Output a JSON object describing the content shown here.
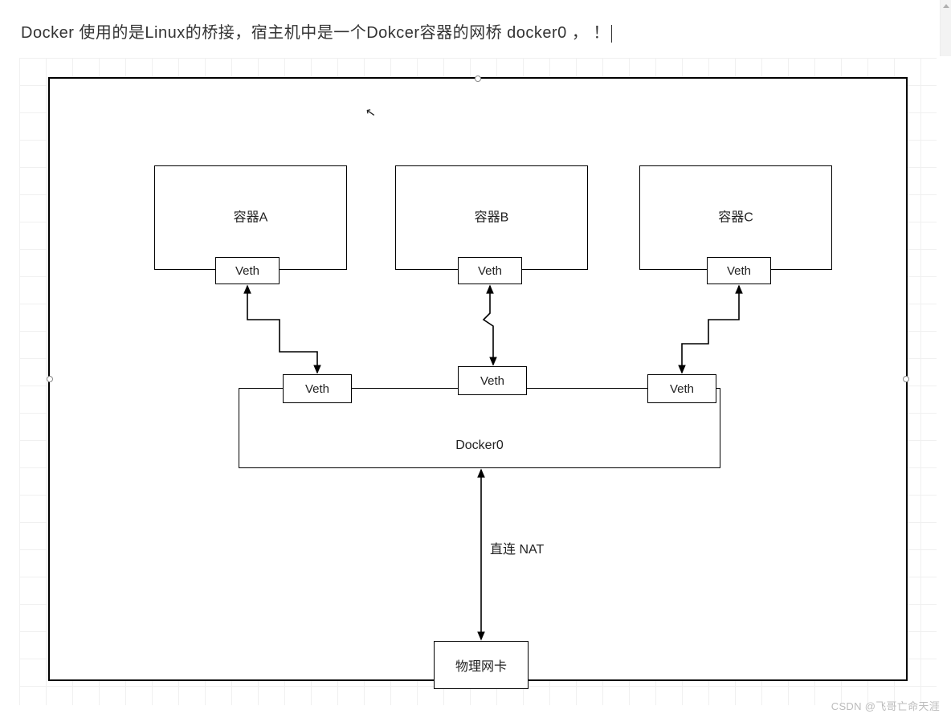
{
  "caption": "Docker 使用的是Linux的桥接，宿主机中是一个Dokcer容器的网桥  docker0 ， ！",
  "containers": [
    {
      "label": "容器A",
      "veth": "Veth"
    },
    {
      "label": "容器B",
      "veth": "Veth"
    },
    {
      "label": "容器C",
      "veth": "Veth"
    }
  ],
  "bridge": {
    "label": "Docker0",
    "veths": [
      "Veth",
      "Veth",
      "Veth"
    ]
  },
  "nat_label": "直连 NAT",
  "nic_label": "物理网卡",
  "watermark": "CSDN @飞哥亡命天涯"
}
